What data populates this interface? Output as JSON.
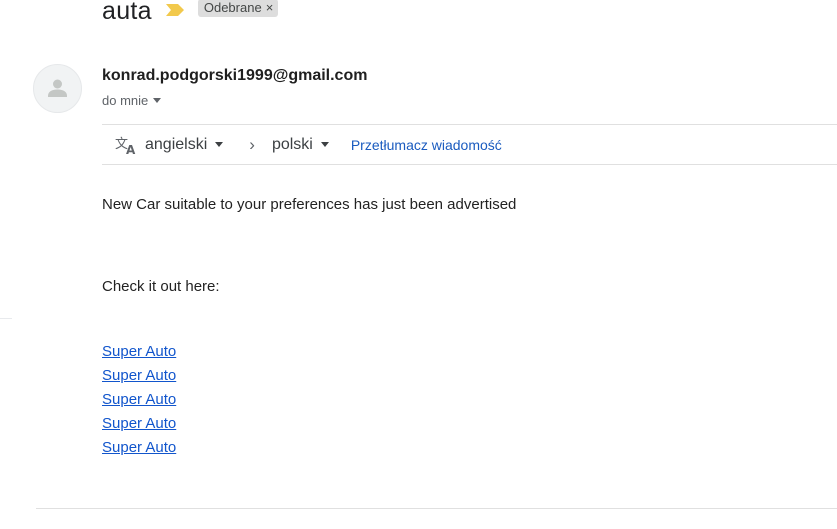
{
  "email": {
    "subject": "auta",
    "importance_icon": "importance-marker-icon",
    "label": {
      "text": "Odebrane",
      "remove_glyph": "×"
    },
    "sender": "konrad.podgorski1999@gmail.com",
    "recipient": "do mnie",
    "avatar_icon": "default-avatar-icon"
  },
  "translate_bar": {
    "icon": "translate-icon",
    "source_language": "angielski",
    "arrow": "›",
    "target_language": "polski",
    "action": "Przetłumacz wiadomość"
  },
  "body": {
    "line1": "New Car suitable to your preferences has just been advertised",
    "line2": "Check it out here:",
    "links": [
      "Super Auto",
      "Super Auto",
      "Super Auto",
      "Super Auto",
      "Super Auto"
    ]
  },
  "colors": {
    "link": "#1155cc",
    "translate_link": "#1a5bbf",
    "importance": "#f2c94c",
    "label_bg": "#dddddd"
  }
}
